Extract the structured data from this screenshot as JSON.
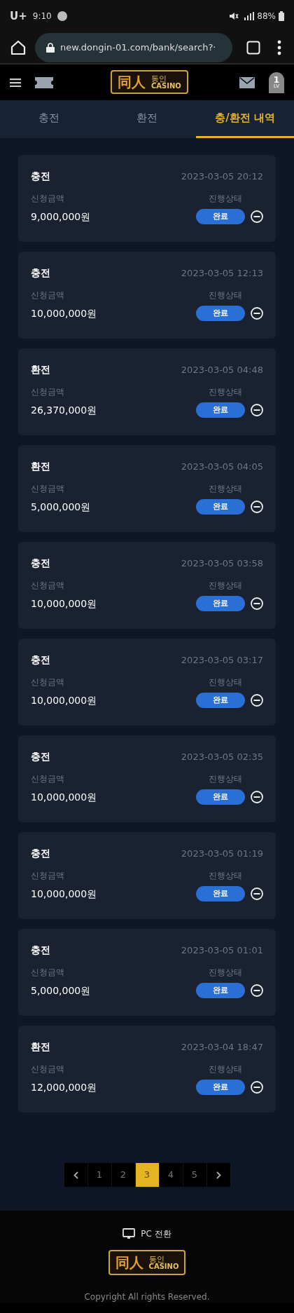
{
  "status_bar": {
    "carrier": "U+",
    "time": "9:10",
    "battery": "88%"
  },
  "browser": {
    "url": "new.dongin-01.com/bank/search?·"
  },
  "header": {
    "logo_hanja": "同人",
    "logo_name": "동인",
    "logo_casino": "CASINO",
    "level": "1",
    "level_label": "LV"
  },
  "tabs": [
    {
      "label": "충전",
      "selected": false
    },
    {
      "label": "환전",
      "selected": false
    },
    {
      "label": "충/환전 내역",
      "selected": true
    }
  ],
  "records": [
    {
      "type": "충전",
      "datetime": "2023-03-05 20:12",
      "amount_label": "신청금액",
      "amount": "9,000,000원",
      "status_label": "진행상태",
      "status": "완료"
    },
    {
      "type": "충전",
      "datetime": "2023-03-05 12:13",
      "amount_label": "신청금액",
      "amount": "10,000,000원",
      "status_label": "진행상태",
      "status": "완료"
    },
    {
      "type": "환전",
      "datetime": "2023-03-05 04:48",
      "amount_label": "신청금액",
      "amount": "26,370,000원",
      "status_label": "진행상태",
      "status": "완료"
    },
    {
      "type": "환전",
      "datetime": "2023-03-05 04:05",
      "amount_label": "신청금액",
      "amount": "5,000,000원",
      "status_label": "진행상태",
      "status": "완료"
    },
    {
      "type": "충전",
      "datetime": "2023-03-05 03:58",
      "amount_label": "신청금액",
      "amount": "10,000,000원",
      "status_label": "진행상태",
      "status": "완료"
    },
    {
      "type": "충전",
      "datetime": "2023-03-05 03:17",
      "amount_label": "신청금액",
      "amount": "10,000,000원",
      "status_label": "진행상태",
      "status": "완료"
    },
    {
      "type": "충전",
      "datetime": "2023-03-05 02:35",
      "amount_label": "신청금액",
      "amount": "10,000,000원",
      "status_label": "진행상태",
      "status": "완료"
    },
    {
      "type": "충전",
      "datetime": "2023-03-05 01:19",
      "amount_label": "신청금액",
      "amount": "10,000,000원",
      "status_label": "진행상태",
      "status": "완료"
    },
    {
      "type": "충전",
      "datetime": "2023-03-05 01:01",
      "amount_label": "신청금액",
      "amount": "5,000,000원",
      "status_label": "진행상태",
      "status": "완료"
    },
    {
      "type": "환전",
      "datetime": "2023-03-04 18:47",
      "amount_label": "신청금액",
      "amount": "12,000,000원",
      "status_label": "진행상태",
      "status": "완료"
    }
  ],
  "pagination": [
    {
      "kind": "prev"
    },
    {
      "kind": "page",
      "label": "1",
      "selected": false
    },
    {
      "kind": "page",
      "label": "2",
      "selected": false
    },
    {
      "kind": "page",
      "label": "3",
      "selected": true
    },
    {
      "kind": "page",
      "label": "4",
      "selected": false
    },
    {
      "kind": "page",
      "label": "5",
      "selected": false
    },
    {
      "kind": "next"
    }
  ],
  "footer": {
    "pc_switch": "PC 전환",
    "logo_hanja": "同人",
    "logo_name": "동인",
    "logo_casino": "CASINO",
    "copyright": "Copyright All rights Reserved."
  }
}
